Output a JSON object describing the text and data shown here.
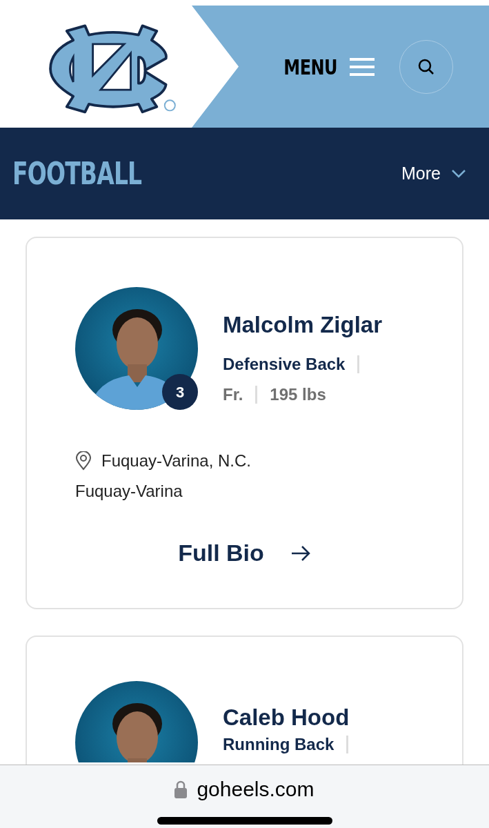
{
  "header": {
    "menu_label": "MENU"
  },
  "section_bar": {
    "title": "FOOTBALL",
    "more_label": "More"
  },
  "players": [
    {
      "name": "Malcolm Ziglar",
      "number": "3",
      "position": "Defensive Back",
      "class_year": "Fr.",
      "weight": "195 lbs",
      "hometown": "Fuquay-Varina, N.C.",
      "school": "Fuquay-Varina",
      "link": "Full Bio"
    },
    {
      "name": "Caleb Hood",
      "position": "Running Back"
    }
  ],
  "browser_bar": {
    "url": "goheels.com"
  }
}
